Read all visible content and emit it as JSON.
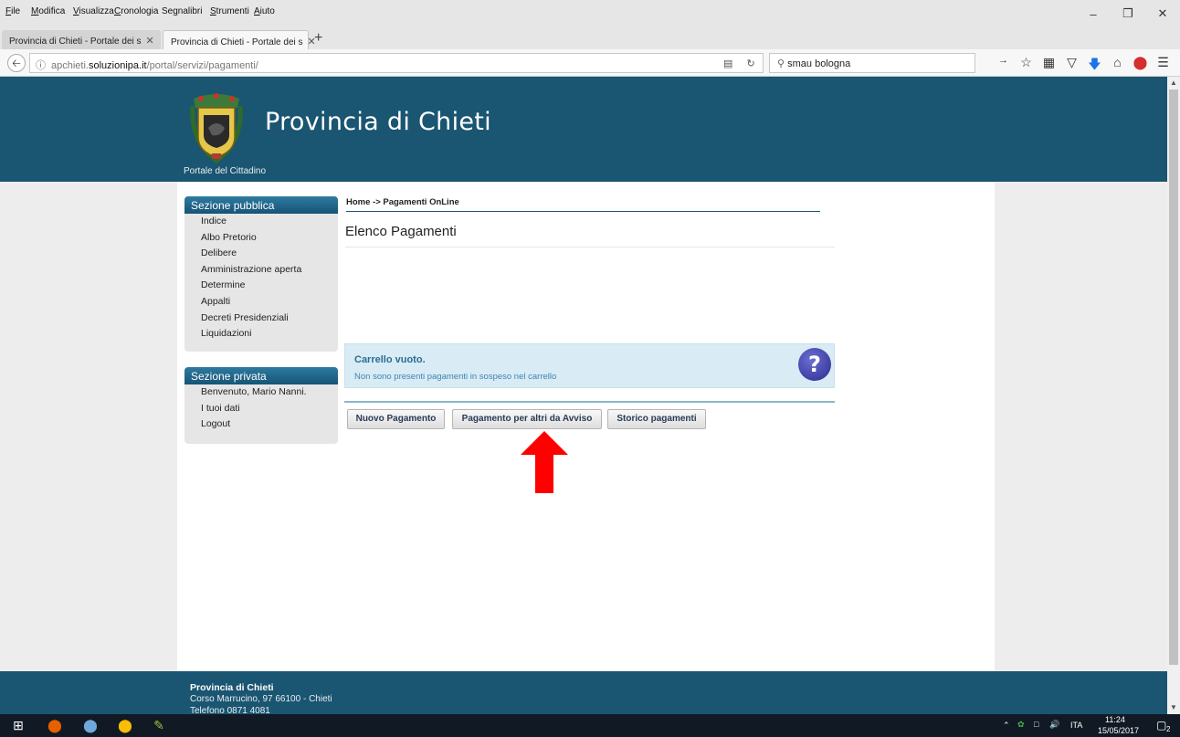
{
  "menubar": {
    "items": [
      {
        "label": "File",
        "accel": "F"
      },
      {
        "label": "Modifica",
        "accel": "M"
      },
      {
        "label": "Visualizza",
        "accel": "V"
      },
      {
        "label": "Cronologia",
        "accel": "C"
      },
      {
        "label": "Segnalibri",
        "accel": "g"
      },
      {
        "label": "Strumenti",
        "accel": "S"
      },
      {
        "label": "Aiuto",
        "accel": "A"
      }
    ]
  },
  "tabs": [
    {
      "label": "Provincia di Chieti - Portale dei s",
      "active": false
    },
    {
      "label": "Provincia di Chieti - Portale dei s",
      "active": true
    }
  ],
  "navbar": {
    "url_prefix": "apchieti.",
    "url_domain": "soluzionipa.it",
    "url_path": "/portal/servizi/pagamenti/",
    "search_value": "smau bologna"
  },
  "header": {
    "title": "Provincia di Chieti",
    "subtitle": "Portale del Cittadino"
  },
  "sidebar": {
    "public": {
      "title": "Sezione pubblica",
      "items": [
        "Indice",
        "Albo Pretorio",
        "Delibere",
        "Amministrazione aperta",
        "Determine",
        "Appalti",
        "Decreti Presidenziali",
        "Liquidazioni"
      ]
    },
    "private": {
      "title": "Sezione privata",
      "items": [
        "Benvenuto, Mario Nanni.",
        "I tuoi dati",
        "Logout"
      ]
    }
  },
  "main": {
    "breadcrumb": "Home -> Pagamenti OnLine",
    "title": "Elenco Pagamenti",
    "alert": {
      "title": "Carrello vuoto.",
      "text": "Non sono presenti pagamenti in sospeso nel carrello"
    },
    "buttons": {
      "new_payment": "Nuovo Pagamento",
      "others_payment": "Pagamento per altri da Avviso",
      "history": "Storico pagamenti"
    }
  },
  "footer": {
    "name": "Provincia di Chieti",
    "address": "Corso Marrucino, 97 66100 - Chieti",
    "phone": "Telefono 0871 4081"
  },
  "taskbar": {
    "language": "ITA",
    "time": "11:24",
    "date": "15/05/2017",
    "notification_count": "2"
  },
  "colors": {
    "header_bg": "#1a5571",
    "alert_bg": "#d9ebf4",
    "arrow": "#ff0000"
  }
}
